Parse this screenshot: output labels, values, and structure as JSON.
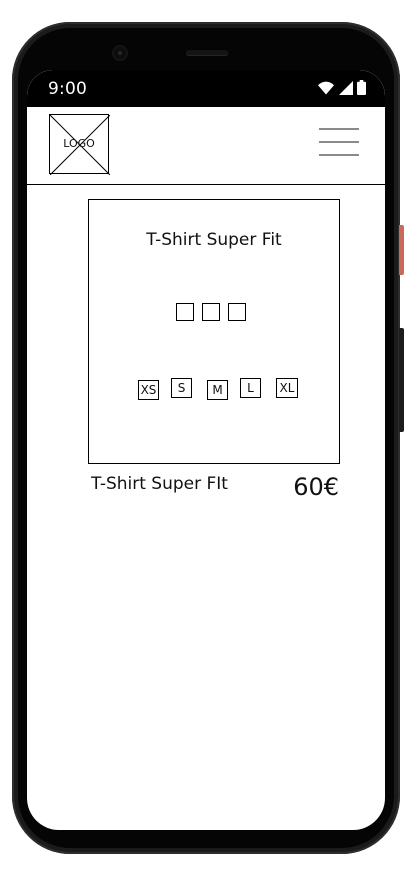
{
  "status_bar": {
    "time": "9:00",
    "icons": [
      "wifi-icon",
      "signal-icon",
      "battery-icon"
    ]
  },
  "header": {
    "logo_text": "LOGO",
    "menu_icon": "hamburger-menu-icon"
  },
  "product": {
    "card_title": "T-Shirt Super Fit",
    "name": "T-Shirt Super FIt",
    "price": "60€",
    "color_swatches": [
      "",
      "",
      ""
    ],
    "sizes": [
      "XS",
      "S",
      "M",
      "L",
      "XL"
    ]
  },
  "colors": {
    "phone_frame": "#1b1b1b",
    "status_bar": "#000000",
    "screen_background": "#ffffff",
    "wireframe_stroke": "#000000",
    "menu_lines": "#8a8a8a",
    "side_button_accent": "#c96a58"
  }
}
